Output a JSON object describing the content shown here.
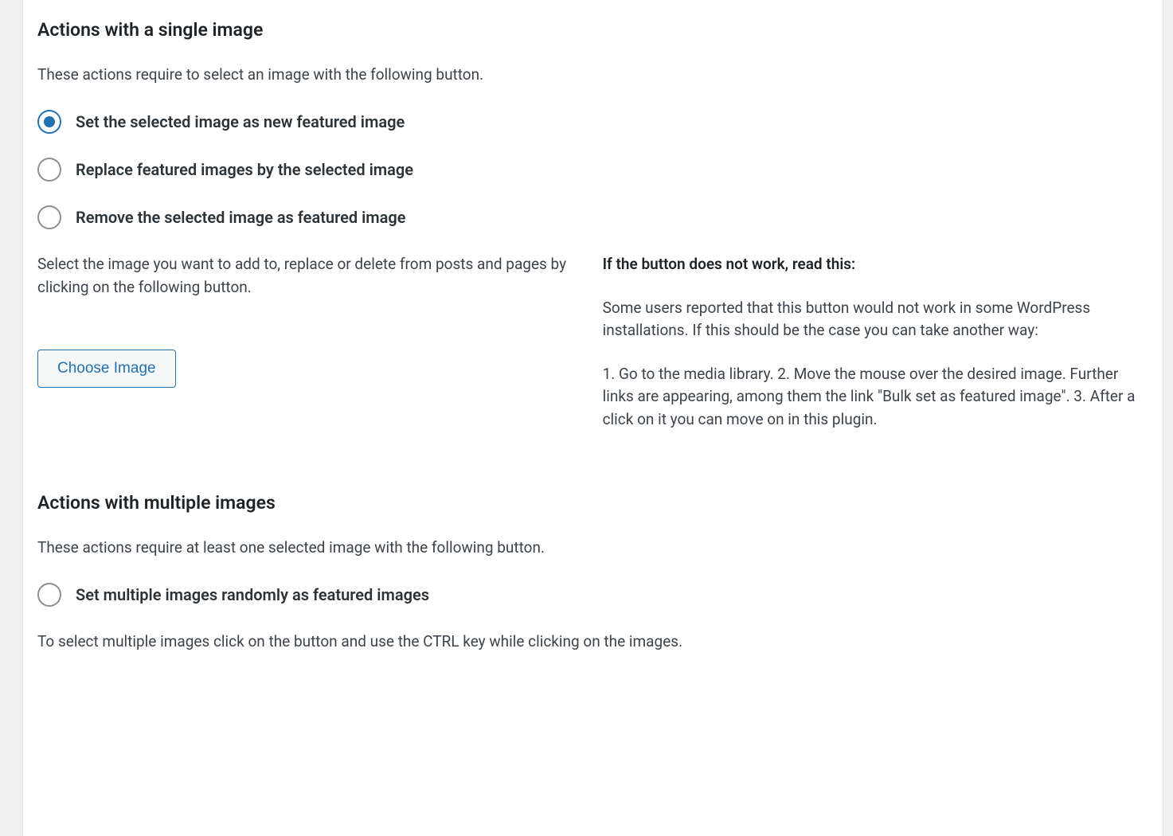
{
  "single": {
    "heading": "Actions with a single image",
    "intro": "These actions require to select an image with the following button.",
    "options": {
      "set": "Set the selected image as new featured image",
      "replace": "Replace featured images by the selected image",
      "remove": "Remove the selected image as featured image"
    },
    "select_text": "Select the image you want to add to, replace or delete from posts and pages by clicking on the following button.",
    "choose_button": "Choose Image",
    "help": {
      "title": "If the button does not work, read this:",
      "p1": "Some users reported that this button would not work in some WordPress installations. If this should be the case you can take another way:",
      "p2": "1. Go to the media library. 2. Move the mouse over the desired image. Further links are appearing, among them the link \"Bulk set as featured image\". 3. After a click on it you can move on in this plugin."
    }
  },
  "multiple": {
    "heading": "Actions with multiple images",
    "intro": "These actions require at least one selected image with the following button.",
    "options": {
      "random": "Set multiple images randomly as featured images"
    },
    "select_text": "To select multiple images click on the button and use the CTRL key while clicking on the images."
  }
}
